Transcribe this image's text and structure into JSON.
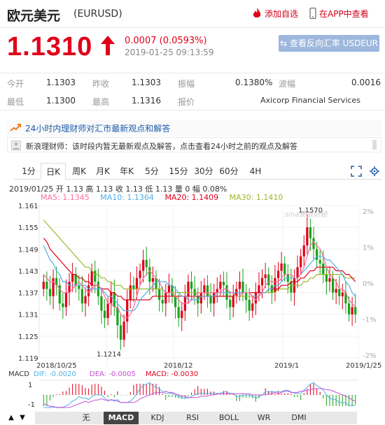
{
  "header": {
    "title": "欧元美元",
    "code": "(EURUSD)",
    "add_fav": "添加自选",
    "app_view": "在APP中查看"
  },
  "quote": {
    "price": "1.1310",
    "change": "0.0007 (0.0593%)",
    "time": "2019-01-25 09:13:59",
    "switch_button": "查看反向汇率 USDEUR",
    "up_color": "#e0001a"
  },
  "stats": [
    {
      "label": "今开",
      "value": "1.1303"
    },
    {
      "label": "昨收",
      "value": "1.1303"
    },
    {
      "label": "振幅",
      "value": "0.1380%"
    },
    {
      "label": "波幅",
      "value": "0.0016"
    },
    {
      "label": "最低",
      "value": "1.1300"
    },
    {
      "label": "最高",
      "value": "1.1316"
    },
    {
      "label": "报价",
      "value": "Axicorp Financial Services"
    }
  ],
  "news": {
    "title": "24小时内理财师对汇市最新观点和解答",
    "row": "新浪理财师：该时段内暂无最新观点及解答，点击查看24小时之前的观点及解答"
  },
  "periods": [
    "1分",
    "日K",
    "周K",
    "月K",
    "年K",
    "5分",
    "15分",
    "30分",
    "60分",
    "4H"
  ],
  "active_period": "日K",
  "kline": {
    "summary": "2019/01/25  开 1.13  高 1.13  收 1.13  低 1.13  量 0  幅 0.08%",
    "ma5": "MA5: 1.1345",
    "ma10": "MA10: 1.1364",
    "ma20": "MA20: 1.1409",
    "ma30": "MA30: 1.1410",
    "watermark": "sina新浪财经",
    "macd": "MACD",
    "dif": "DIF: -0.0020",
    "dea": "DEA: -0.0005",
    "macd_val": "MACD: -0.0030"
  },
  "indicators": [
    "无",
    "MACD",
    "KDJ",
    "RSI",
    "BOLL",
    "WR",
    "DMI"
  ],
  "active_indicator": "MACD",
  "colors": {
    "up": "#e0001a",
    "down": "#1aa31a",
    "ma5": "#ff6ea0",
    "ma10": "#4fb0e6",
    "ma20": "#e0001a",
    "ma30": "#9bb82d"
  },
  "chart_data": {
    "type": "candlestick",
    "y_labels": [
      "1.161",
      "1.155",
      "1.149",
      "1.143",
      "1.137",
      "1.131",
      "1.125",
      "1.119"
    ],
    "y_right_labels": [
      "2%",
      "1%",
      "0%",
      "-1%",
      "-2%"
    ],
    "x_labels": [
      "2018/10/25",
      "2018/12",
      "2019/1",
      "2019/1/25"
    ],
    "high_annotation": "1.1570",
    "low_annotation": "1.1214",
    "macd_y_labels": [
      "1",
      "-1"
    ],
    "ylim": [
      1.119,
      1.161
    ],
    "closes": [
      1.14,
      1.138,
      1.136,
      1.141,
      1.139,
      1.134,
      1.133,
      1.137,
      1.14,
      1.142,
      1.139,
      1.138,
      1.134,
      1.136,
      1.139,
      1.143,
      1.14,
      1.136,
      1.132,
      1.13,
      1.134,
      1.137,
      1.133,
      1.128,
      1.124,
      1.129,
      1.135,
      1.139,
      1.138,
      1.141,
      1.143,
      1.146,
      1.144,
      1.14,
      1.141,
      1.138,
      1.135,
      1.134,
      1.137,
      1.139,
      1.136,
      1.133,
      1.13,
      1.132,
      1.136,
      1.14,
      1.138,
      1.136,
      1.134,
      1.137,
      1.139,
      1.136,
      1.134,
      1.137,
      1.138,
      1.14,
      1.139,
      1.135,
      1.133,
      1.136,
      1.138,
      1.14,
      1.137,
      1.135,
      1.132,
      1.134,
      1.137,
      1.139,
      1.141,
      1.142,
      1.139,
      1.137,
      1.141,
      1.143,
      1.145,
      1.142,
      1.14,
      1.137,
      1.141,
      1.144,
      1.147,
      1.15,
      1.155,
      1.152,
      1.149,
      1.146,
      1.145,
      1.142,
      1.14,
      1.141,
      1.137,
      1.138,
      1.136,
      1.137,
      1.134,
      1.131,
      1.133,
      1.131
    ],
    "ma5": [
      1.142,
      1.141,
      1.14,
      1.14,
      1.139,
      1.138,
      1.137,
      1.137,
      1.137,
      1.138,
      1.139,
      1.14,
      1.139,
      1.138,
      1.137,
      1.138,
      1.139,
      1.139,
      1.138,
      1.136,
      1.134,
      1.134,
      1.133,
      1.133,
      1.131,
      1.13,
      1.13,
      1.131,
      1.133,
      1.136,
      1.139,
      1.141,
      1.142,
      1.143,
      1.142,
      1.141,
      1.14,
      1.138,
      1.137,
      1.137,
      1.137,
      1.136,
      1.135,
      1.134,
      1.134,
      1.134,
      1.135,
      1.136,
      1.137,
      1.137,
      1.137,
      1.137,
      1.137,
      1.137,
      1.137,
      1.137,
      1.138,
      1.138,
      1.137,
      1.137,
      1.136,
      1.136,
      1.137,
      1.137,
      1.137,
      1.136,
      1.135,
      1.136,
      1.137,
      1.139,
      1.14,
      1.14,
      1.14,
      1.14,
      1.141,
      1.142,
      1.142,
      1.142,
      1.141,
      1.141,
      1.142,
      1.144,
      1.147,
      1.15,
      1.151,
      1.15,
      1.149,
      1.147,
      1.144,
      1.142,
      1.141,
      1.14,
      1.138,
      1.138,
      1.137,
      1.135,
      1.134,
      1.133
    ],
    "ma10": [
      1.15,
      1.148,
      1.146,
      1.145,
      1.143,
      1.142,
      1.14,
      1.14,
      1.139,
      1.139,
      1.139,
      1.139,
      1.139,
      1.139,
      1.138,
      1.138,
      1.138,
      1.138,
      1.138,
      1.137,
      1.136,
      1.136,
      1.135,
      1.134,
      1.133,
      1.132,
      1.132,
      1.132,
      1.132,
      1.133,
      1.135,
      1.136,
      1.137,
      1.138,
      1.139,
      1.14,
      1.14,
      1.14,
      1.14,
      1.139,
      1.139,
      1.138,
      1.137,
      1.136,
      1.136,
      1.135,
      1.135,
      1.135,
      1.135,
      1.136,
      1.136,
      1.136,
      1.136,
      1.136,
      1.137,
      1.137,
      1.137,
      1.137,
      1.137,
      1.137,
      1.137,
      1.137,
      1.137,
      1.137,
      1.137,
      1.136,
      1.136,
      1.136,
      1.137,
      1.137,
      1.138,
      1.138,
      1.139,
      1.139,
      1.14,
      1.141,
      1.141,
      1.141,
      1.141,
      1.141,
      1.142,
      1.143,
      1.144,
      1.145,
      1.146,
      1.147,
      1.147,
      1.147,
      1.146,
      1.146,
      1.145,
      1.144,
      1.143,
      1.142,
      1.14,
      1.139,
      1.137,
      1.136
    ],
    "ma20": [
      1.152,
      1.151,
      1.149,
      1.148,
      1.147,
      1.146,
      1.145,
      1.144,
      1.143,
      1.142,
      1.142,
      1.141,
      1.141,
      1.14,
      1.14,
      1.139,
      1.139,
      1.139,
      1.138,
      1.138,
      1.138,
      1.137,
      1.137,
      1.136,
      1.136,
      1.135,
      1.135,
      1.135,
      1.135,
      1.135,
      1.135,
      1.135,
      1.135,
      1.135,
      1.136,
      1.136,
      1.136,
      1.136,
      1.136,
      1.136,
      1.136,
      1.136,
      1.136,
      1.136,
      1.136,
      1.136,
      1.136,
      1.136,
      1.136,
      1.136,
      1.136,
      1.136,
      1.136,
      1.136,
      1.136,
      1.136,
      1.136,
      1.136,
      1.136,
      1.136,
      1.137,
      1.137,
      1.137,
      1.137,
      1.137,
      1.137,
      1.137,
      1.137,
      1.137,
      1.137,
      1.138,
      1.138,
      1.138,
      1.138,
      1.139,
      1.139,
      1.139,
      1.14,
      1.14,
      1.14,
      1.141,
      1.141,
      1.142,
      1.143,
      1.143,
      1.144,
      1.144,
      1.144,
      1.144,
      1.144,
      1.144,
      1.143,
      1.143,
      1.143,
      1.142,
      1.142,
      1.141,
      1.14
    ],
    "ma30": [
      1.157,
      1.156,
      1.155,
      1.154,
      1.153,
      1.152,
      1.151,
      1.15,
      1.149,
      1.148,
      1.147,
      1.146,
      1.145,
      1.144,
      1.144,
      1.143,
      1.142,
      1.142,
      1.141,
      1.141,
      1.14,
      1.14,
      1.139,
      1.139,
      1.139,
      1.138,
      1.138,
      1.138,
      1.138,
      1.138,
      1.138,
      1.138,
      1.138,
      1.138,
      1.138,
      1.138,
      1.138,
      1.138,
      1.137,
      1.137,
      1.137,
      1.137,
      1.137,
      1.137,
      1.137,
      1.137,
      1.137,
      1.137,
      1.137,
      1.137,
      1.137,
      1.137,
      1.136,
      1.136,
      1.136,
      1.136,
      1.136,
      1.136,
      1.136,
      1.136,
      1.136,
      1.136,
      1.136,
      1.136,
      1.136,
      1.136,
      1.136,
      1.136,
      1.137,
      1.137,
      1.137,
      1.137,
      1.137,
      1.138,
      1.138,
      1.138,
      1.138,
      1.139,
      1.139,
      1.139,
      1.139,
      1.14,
      1.14,
      1.141,
      1.141,
      1.142,
      1.142,
      1.142,
      1.142,
      1.142,
      1.142,
      1.142,
      1.142,
      1.142,
      1.141,
      1.141,
      1.141,
      1.141
    ]
  }
}
